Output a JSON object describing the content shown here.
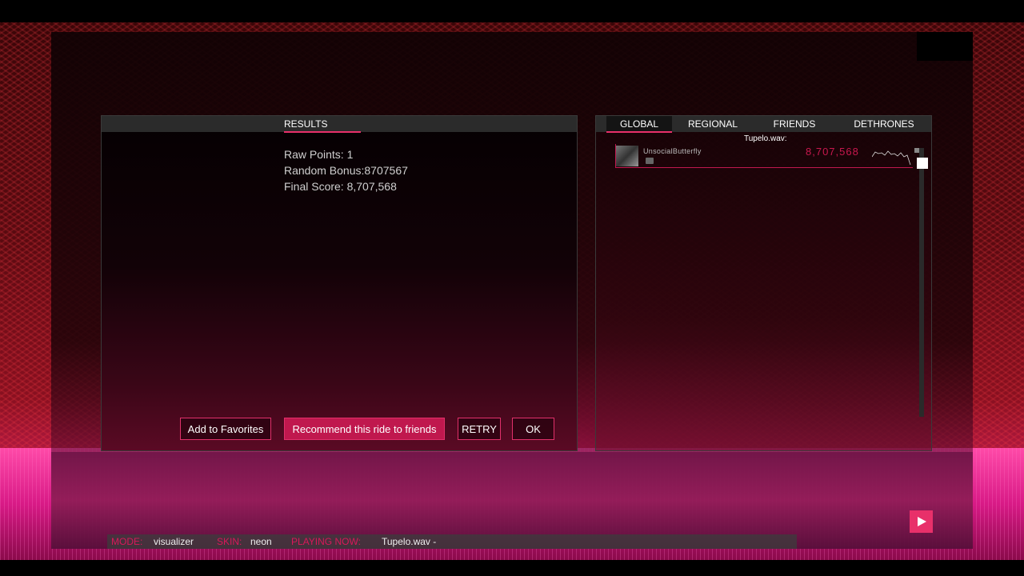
{
  "results": {
    "tab_label": "RESULTS",
    "raw_points": "Raw Points: 1",
    "random_bonus": "Random Bonus:8707567",
    "final_score": "Final Score: 8,707,568",
    "buttons": {
      "favorites": "Add to Favorites",
      "recommend": "Recommend this ride to friends",
      "retry": "RETRY",
      "ok": "OK"
    }
  },
  "leaderboard": {
    "tabs": [
      "GLOBAL",
      "REGIONAL",
      "FRIENDS",
      "DETHRONES"
    ],
    "active_tab": "GLOBAL",
    "song_title": "Tupelo.wav:",
    "entries": [
      {
        "name": "UnsocialButterfly",
        "score": "8,707,568"
      }
    ]
  },
  "statusbar": {
    "mode_label": "MODE:",
    "mode_value": "visualizer",
    "skin_label": "SKIN:",
    "skin_value": "neon",
    "playing_label": "PLAYING NOW:",
    "playing_value": "Tupelo.wav -"
  },
  "colors": {
    "accent": "#e8306a",
    "accent_dark": "#c0184e",
    "panel_header": "#2b2b2b"
  },
  "icons": {
    "play": "play-icon",
    "flag": "flag-icon"
  }
}
